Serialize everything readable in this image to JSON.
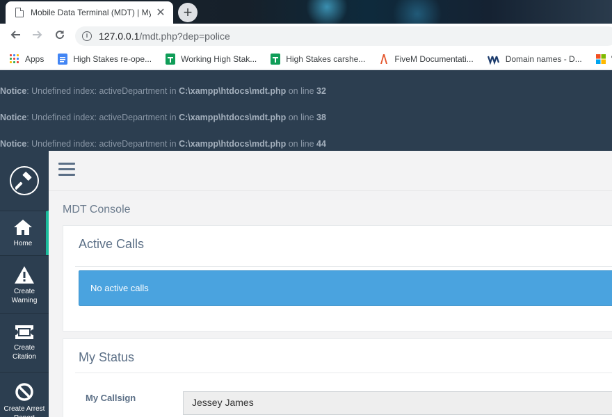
{
  "browser": {
    "tab_title": "Mobile Data Terminal (MDT) | My",
    "close_glyph": "✕",
    "new_tab_glyph": "+",
    "url_host": "127.0.0.1",
    "url_path": "/mdt.php?dep=police",
    "bookmarks": [
      {
        "label": "Apps",
        "icon": "apps-grid-icon"
      },
      {
        "label": "High Stakes re-ope...",
        "icon": "google-docs-icon",
        "color": "#4285f4"
      },
      {
        "label": "Working High Stak...",
        "icon": "google-sheets-icon",
        "color": "#0f9d58"
      },
      {
        "label": "High Stakes carshe...",
        "icon": "google-sheets-icon",
        "color": "#0f9d58"
      },
      {
        "label": "FiveM Documentati...",
        "icon": "fivem-icon",
        "color": "#e4572e"
      },
      {
        "label": "Domain names - D...",
        "icon": "domain-icon",
        "color": "#1a3a6b"
      },
      {
        "label": "\"",
        "icon": "windows-icon"
      }
    ]
  },
  "notices": [
    {
      "label": "Notice",
      "text": ": Undefined index: activeDepartment in ",
      "path": "C:\\xampp\\htdocs\\mdt.php",
      "online": " on line ",
      "line": "32"
    },
    {
      "label": "Notice",
      "text": ": Undefined index: activeDepartment in ",
      "path": "C:\\xampp\\htdocs\\mdt.php",
      "online": " on line ",
      "line": "38"
    },
    {
      "label": "Notice",
      "text": ": Undefined index: activeDepartment in ",
      "path": "C:\\xampp\\htdocs\\mdt.php",
      "online": " on line ",
      "line": "44"
    }
  ],
  "sidebar": {
    "logo_icon": "gavel-icon",
    "items": [
      {
        "label": "Home",
        "icon": "home-icon",
        "active": true
      },
      {
        "label": "Create\nWarning",
        "icon": "warning-icon"
      },
      {
        "label": "Create\nCitation",
        "icon": "ticket-icon"
      },
      {
        "label": "Create Arrest\nReport",
        "icon": "ban-icon"
      }
    ]
  },
  "main": {
    "page_title": "MDT Console",
    "active_calls": {
      "title": "Active Calls",
      "alert_text": "No active calls"
    },
    "my_status": {
      "title": "My Status",
      "callsign_label": "My Callsign",
      "callsign_value": "Jessey James"
    }
  },
  "colors": {
    "sidebar_bg": "#2c3e50",
    "accent": "#1abc9c",
    "alert_bg": "#4aa3df"
  }
}
